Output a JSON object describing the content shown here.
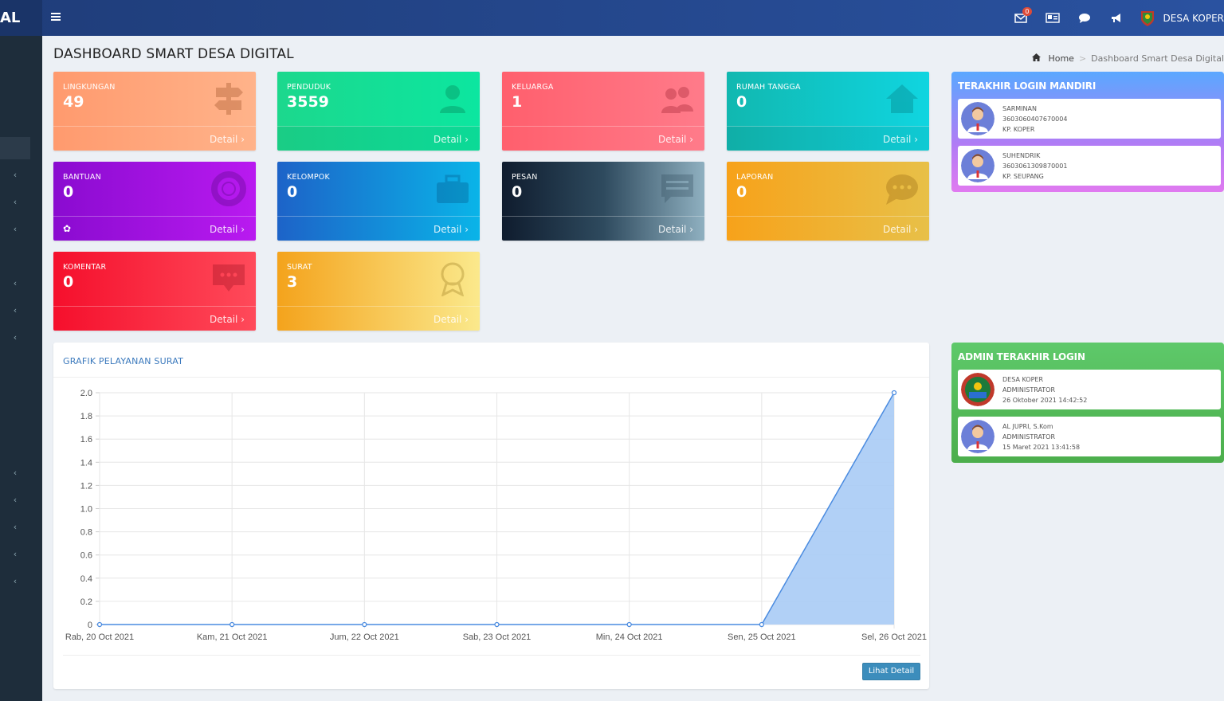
{
  "navbar": {
    "brand": "AL",
    "badge_count": "0",
    "user_name": "DESA KOPER"
  },
  "page": {
    "title": "DASHBOARD SMART DESA DIGITAL",
    "breadcrumb_home": "Home",
    "breadcrumb_current": "Dashboard Smart Desa Digital"
  },
  "boxes": [
    {
      "label": "LINGKUNGAN",
      "value": "49",
      "detail": "Detail"
    },
    {
      "label": "PENDUDUK",
      "value": "3559",
      "detail": "Detail"
    },
    {
      "label": "KELUARGA",
      "value": "1",
      "detail": "Detail"
    },
    {
      "label": "RUMAH TANGGA",
      "value": "0",
      "detail": "Detail"
    },
    {
      "label": "BANTUAN",
      "value": "0",
      "detail": "Detail"
    },
    {
      "label": "KELOMPOK",
      "value": "0",
      "detail": "Detail"
    },
    {
      "label": "PESAN",
      "value": "0",
      "detail": "Detail"
    },
    {
      "label": "LAPORAN",
      "value": "0",
      "detail": "Detail"
    },
    {
      "label": "KOMENTAR",
      "value": "0",
      "detail": "Detail"
    },
    {
      "label": "SURAT",
      "value": "3",
      "detail": "Detail"
    }
  ],
  "chart_panel": {
    "title": "GRAFIK PELAYANAN SURAT",
    "button": "Lihat Detail"
  },
  "chart_data": {
    "type": "area",
    "title": "",
    "xlabel": "",
    "ylabel": "",
    "x": [
      "Rab, 20 Oct 2021",
      "Kam, 21 Oct 2021",
      "Jum, 22 Oct 2021",
      "Sab, 23 Oct 2021",
      "Min, 24 Oct 2021",
      "Sen, 25 Oct 2021",
      "Sel, 26 Oct 2021"
    ],
    "values": [
      0,
      0,
      0,
      0,
      0,
      0,
      2
    ],
    "ylim": [
      0,
      2
    ],
    "yticks": [
      "0",
      "0.2",
      "0.4",
      "0.6",
      "0.8",
      "1.0",
      "1.2",
      "1.4",
      "1.6",
      "1.8",
      "2.0"
    ],
    "grid": true,
    "fill_color": "#a9cbf5",
    "line_color": "#4a8be0"
  },
  "login_mandiri": {
    "title": "TERAKHIR LOGIN MANDIRI",
    "items": [
      {
        "name": "SARMINAN",
        "nik": "3603060407670004",
        "address": "KP. KOPER"
      },
      {
        "name": "SUHENDRIK",
        "nik": "3603061309870001",
        "address": "KP. SEUPANG"
      }
    ]
  },
  "admin_login": {
    "title": "ADMIN TERAKHIR LOGIN",
    "items": [
      {
        "name": "DESA KOPER",
        "role": "ADMINISTRATOR",
        "time": "26 Oktober 2021 14:42:52"
      },
      {
        "name": "AL JUPRI, S.Kom",
        "role": "ADMINISTRATOR",
        "time": "15 Maret 2021 13:41:58"
      }
    ]
  },
  "colors": {
    "navbar": "#2a52a0",
    "sidebar": "#1e2d3b",
    "accent": "#3c8dbc"
  }
}
